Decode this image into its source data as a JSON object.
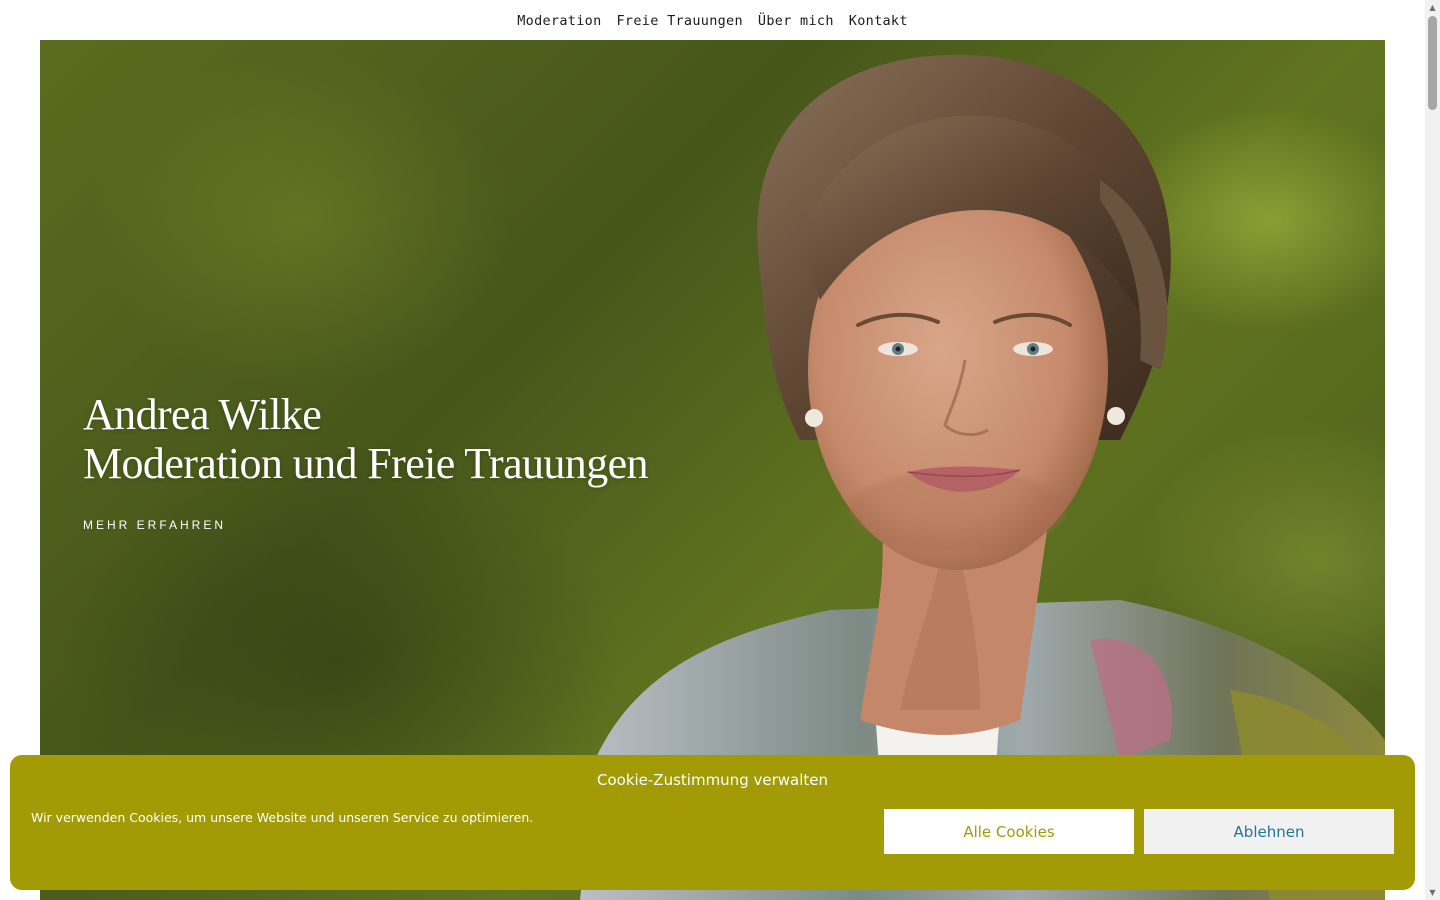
{
  "nav": {
    "items": [
      {
        "label": "Moderation"
      },
      {
        "label": "Freie Trauungen"
      },
      {
        "label": "Über mich"
      },
      {
        "label": "Kontakt"
      }
    ]
  },
  "hero": {
    "title_line1": "Andrea Wilke",
    "title_line2": "Moderation und Freie Trauungen",
    "cta_label": "MEHR ERFAHREN",
    "background_color": "#4f5f1c"
  },
  "cookie_banner": {
    "title": "Cookie-Zustimmung verwalten",
    "text": "Wir verwenden Cookies, um unsere Website und unseren Service zu optimieren.",
    "accept_label": "Alle Cookies",
    "deny_label": "Ablehnen",
    "background_color": "#a29b06",
    "accept_text_color": "#a29b06",
    "deny_text_color": "#21759b"
  }
}
